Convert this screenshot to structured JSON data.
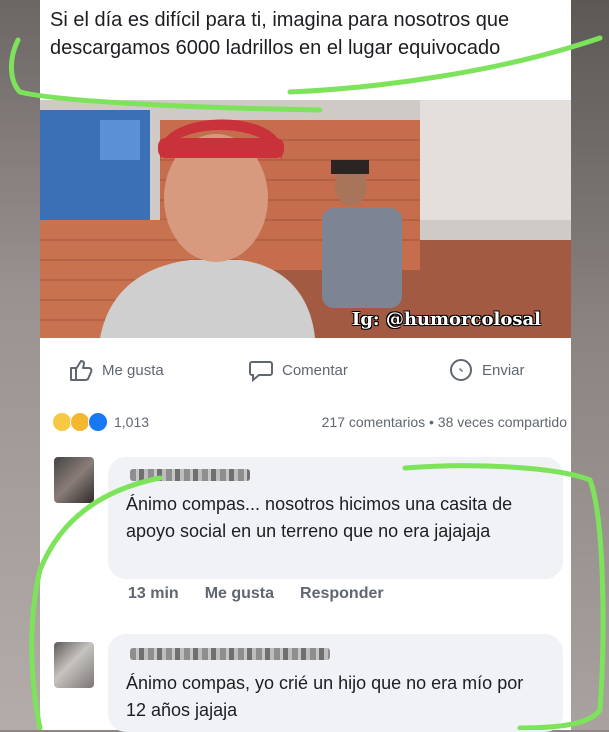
{
  "post": {
    "caption": "Si el día es difícil para ti, imagina para nosotros que descargamos 6000 ladrillos en el lugar equivocado",
    "watermark": "Ig: @humorcolosal"
  },
  "actions": {
    "like_label": "Me gusta",
    "comment_label": "Comentar",
    "send_label": "Enviar"
  },
  "stats": {
    "reaction_count": "1,013",
    "comments_shares": "217 comentarios • 38 veces compartido"
  },
  "comments": [
    {
      "text": "Ánimo compas... nosotros hicimos una casita de apoyo social en un terreno que no era jajajaja",
      "time": "13 min",
      "like_label": "Me gusta",
      "reply_label": "Responder"
    },
    {
      "text": "Ánimo compas, yo crié un hijo que no era mío por 12 años jajaja"
    }
  ],
  "colors": {
    "highlight_green": "#7de35a",
    "text": "#1c1e21",
    "muted": "#606770",
    "bubble": "#f0f2f5"
  },
  "icons": [
    "thumbs-up-icon",
    "comment-icon",
    "messenger-icon",
    "reaction-haha-icon",
    "reaction-like-icon"
  ]
}
